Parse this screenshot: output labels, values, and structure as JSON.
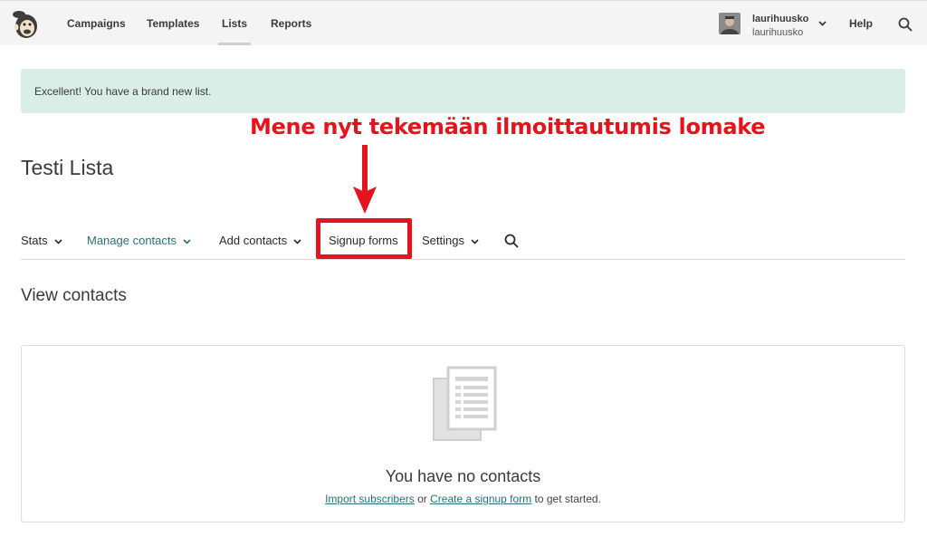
{
  "topbar": {
    "nav": [
      {
        "label": "Campaigns",
        "active": false
      },
      {
        "label": "Templates",
        "active": false
      },
      {
        "label": "Lists",
        "active": true
      },
      {
        "label": "Reports",
        "active": false
      }
    ],
    "user": {
      "name": "laurihuusko",
      "account": "laurihuusko"
    },
    "help_label": "Help"
  },
  "alert": {
    "text": "Excellent! You have a brand new list."
  },
  "annotation": {
    "text": "Mene nyt tekemään ilmoittautumis lomake",
    "color": "#e5131b"
  },
  "page": {
    "title": "Testi Lista"
  },
  "subnav": {
    "items": [
      {
        "label": "Stats",
        "dropdown": true,
        "active": false
      },
      {
        "label": "Manage contacts",
        "dropdown": true,
        "active": true
      },
      {
        "label": "Add contacts",
        "dropdown": true,
        "active": false
      },
      {
        "label": "Signup forms",
        "dropdown": false,
        "active": false,
        "highlighted": true
      },
      {
        "label": "Settings",
        "dropdown": true,
        "active": false
      }
    ]
  },
  "section": {
    "title": "View contacts"
  },
  "empty_state": {
    "title": "You have no contacts",
    "link1": "Import subscribers",
    "connector": " or ",
    "link2": "Create a signup form",
    "suffix": " to get started."
  },
  "colors": {
    "accent": "#29707a",
    "annotation": "#e5131b",
    "alert_bg": "#d9eee6"
  }
}
